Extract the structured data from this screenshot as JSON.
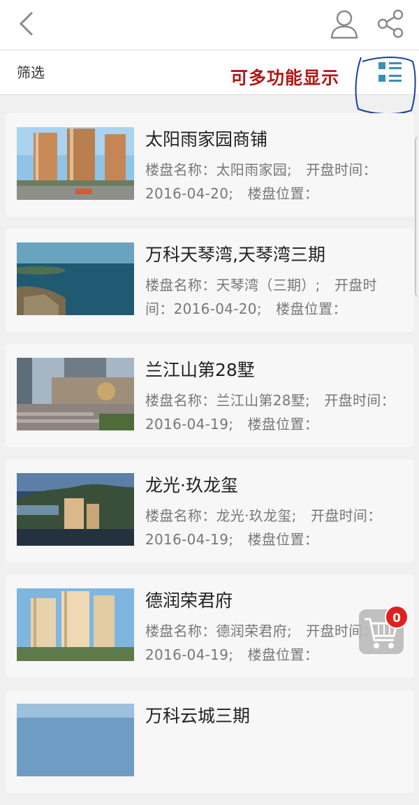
{
  "header": {
    "back_icon": "chevron-left-icon",
    "user_icon": "user-icon",
    "share_icon": "share-icon"
  },
  "filter_bar": {
    "filter_label": "筛选",
    "annotation": "可多功能显示",
    "view_toggle_icon": "list-view-icon",
    "annotation_color": "#b01818",
    "circle_color": "#1a3f9a"
  },
  "listings": [
    {
      "title": "太阳雨家园商铺",
      "desc": "楼盘名称：太阳雨家园;　开盘时间：2016-04-20;　楼盘位置：",
      "thumb": "city-towers-photo"
    },
    {
      "title": "万科天琴湾,天琴湾三期",
      "desc": "楼盘名称：天琴湾（三期）;　开盘时间：2016-04-20;　楼盘位置：",
      "thumb": "seaside-bay-photo"
    },
    {
      "title": "兰江山第28墅",
      "desc": "楼盘名称：兰江山第28墅;　开盘时间：2016-04-19;　楼盘位置：",
      "thumb": "estate-entrance-photo"
    },
    {
      "title": "龙光·玖龙玺",
      "desc": "楼盘名称：龙光·玖龙玺;　开盘时间：2016-04-19;　楼盘位置：",
      "thumb": "mountain-night-photo"
    },
    {
      "title": "德润荣君府",
      "desc": "楼盘名称：德润荣君府;　开盘时间：2016-04-19;　楼盘位置：",
      "thumb": "residential-towers-photo"
    },
    {
      "title": "万科云城三期",
      "desc": "",
      "thumb": "city-photo"
    }
  ],
  "cart": {
    "icon": "cart-icon",
    "count": "0"
  }
}
